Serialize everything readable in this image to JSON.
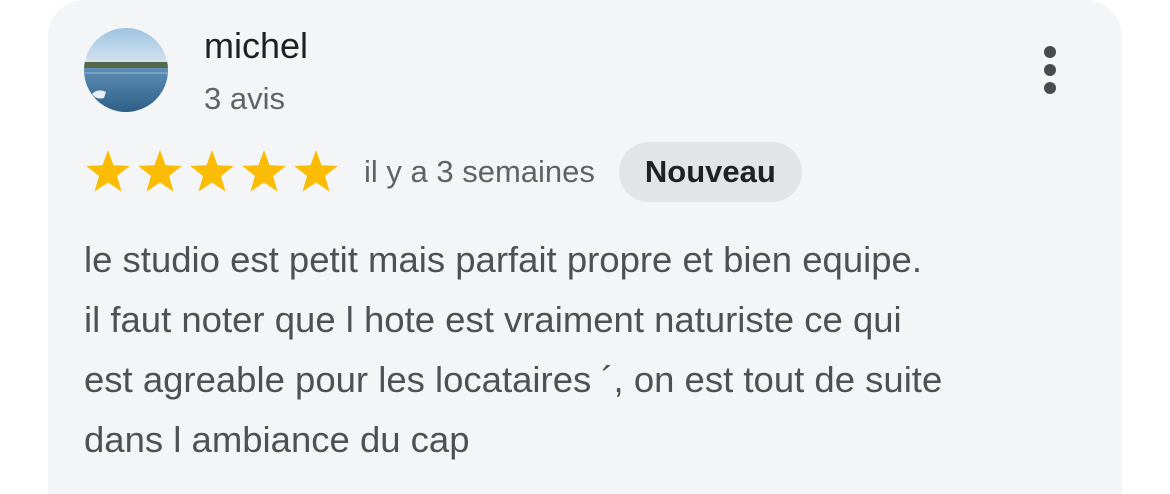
{
  "review": {
    "author": {
      "name": "michel",
      "review_count": "3 avis",
      "avatar_icon": "lake-landscape-avatar"
    },
    "more_options_icon": "more-vertical-icon",
    "rating": {
      "stars": 5,
      "max_stars": 5,
      "star_color": "#fbbc04"
    },
    "date": "il y a 3 semaines",
    "badge": "Nouveau",
    "text_lines": [
      "le studio est petit mais parfait propre et bien equipe.",
      "il faut noter que l hote est vraiment naturiste ce qui",
      "est agreable pour les locataires ´, on est tout de suite",
      "dans l ambiance du cap"
    ]
  },
  "colors": {
    "card_background": "#f4f5f7",
    "badge_background": "#e2e4e7",
    "primary_text": "#202124",
    "secondary_text": "#5f6368"
  }
}
